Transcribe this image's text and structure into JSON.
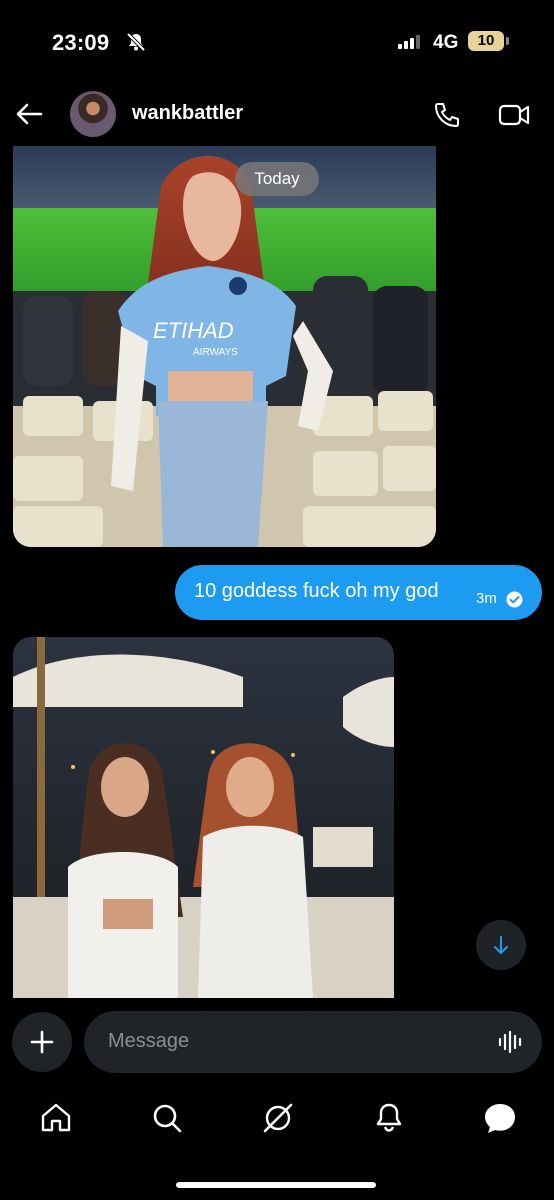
{
  "status_bar": {
    "time": "23:09",
    "network": "4G",
    "battery": "10"
  },
  "header": {
    "username": "wankbattler"
  },
  "chat": {
    "date_separator": "Today",
    "messages": [
      {
        "type": "image",
        "from": "them"
      },
      {
        "type": "text",
        "from": "me",
        "text": "10 goddess fuck oh my god",
        "time": "3m",
        "status": "read"
      },
      {
        "type": "image",
        "from": "them"
      }
    ]
  },
  "image1": {
    "jersey_text": "ETIHAD",
    "jersey_subtext": "AIRWAYS"
  },
  "composer": {
    "placeholder": "Message"
  },
  "nav": [
    {
      "icon": "home-icon"
    },
    {
      "icon": "search-icon"
    },
    {
      "icon": "grok-icon"
    },
    {
      "icon": "notifications-icon"
    },
    {
      "icon": "messages-icon"
    }
  ],
  "colors": {
    "accent": "#1d9bf0",
    "background": "#000000",
    "field": "#202327",
    "battery": "#e6d39a"
  }
}
